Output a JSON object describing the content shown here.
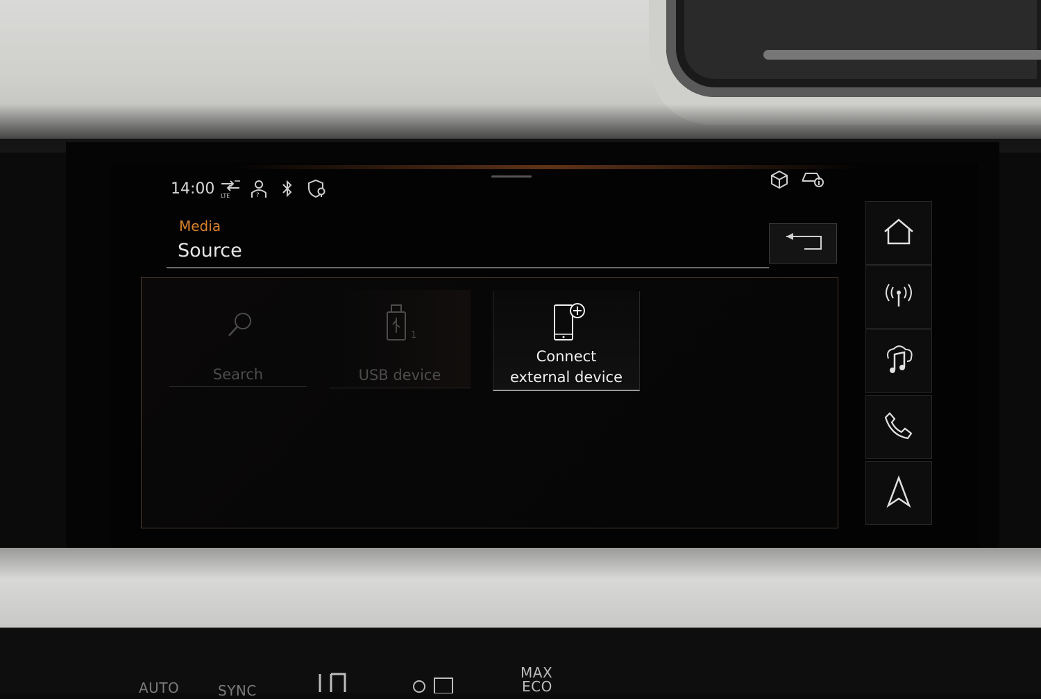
{
  "status_bar": {
    "time": "14:00",
    "icons": [
      "lte-signal-icon",
      "user-profile-icon",
      "bluetooth-icon",
      "privacy-location-icon",
      "package-icon",
      "vehicle-info-icon"
    ],
    "lte_label": "LTE"
  },
  "header": {
    "kicker": "Media",
    "title": "Source",
    "back_icon": "back-arrow-icon"
  },
  "source_tiles": [
    {
      "label": "Search",
      "icon": "search-icon",
      "enabled": false
    },
    {
      "label": "USB device",
      "icon": "usb-icon",
      "enabled": false,
      "badge": "1"
    },
    {
      "label_line1": "Connect",
      "label_line2": "external device",
      "icon": "add-phone-icon",
      "enabled": true
    }
  ],
  "nav_rail": [
    {
      "icon": "home-icon"
    },
    {
      "icon": "radio-broadcast-icon"
    },
    {
      "icon": "media-music-icon"
    },
    {
      "icon": "phone-icon"
    },
    {
      "icon": "navigation-arrow-icon"
    }
  ],
  "climate": {
    "auto": "AUTO",
    "sync": "SYNC",
    "max": "MAX",
    "eco": "ECO"
  },
  "colors": {
    "accent": "#d9822b",
    "text_primary": "#e6e6e6",
    "text_disabled": "#4c4c4c",
    "background": "#030303"
  }
}
